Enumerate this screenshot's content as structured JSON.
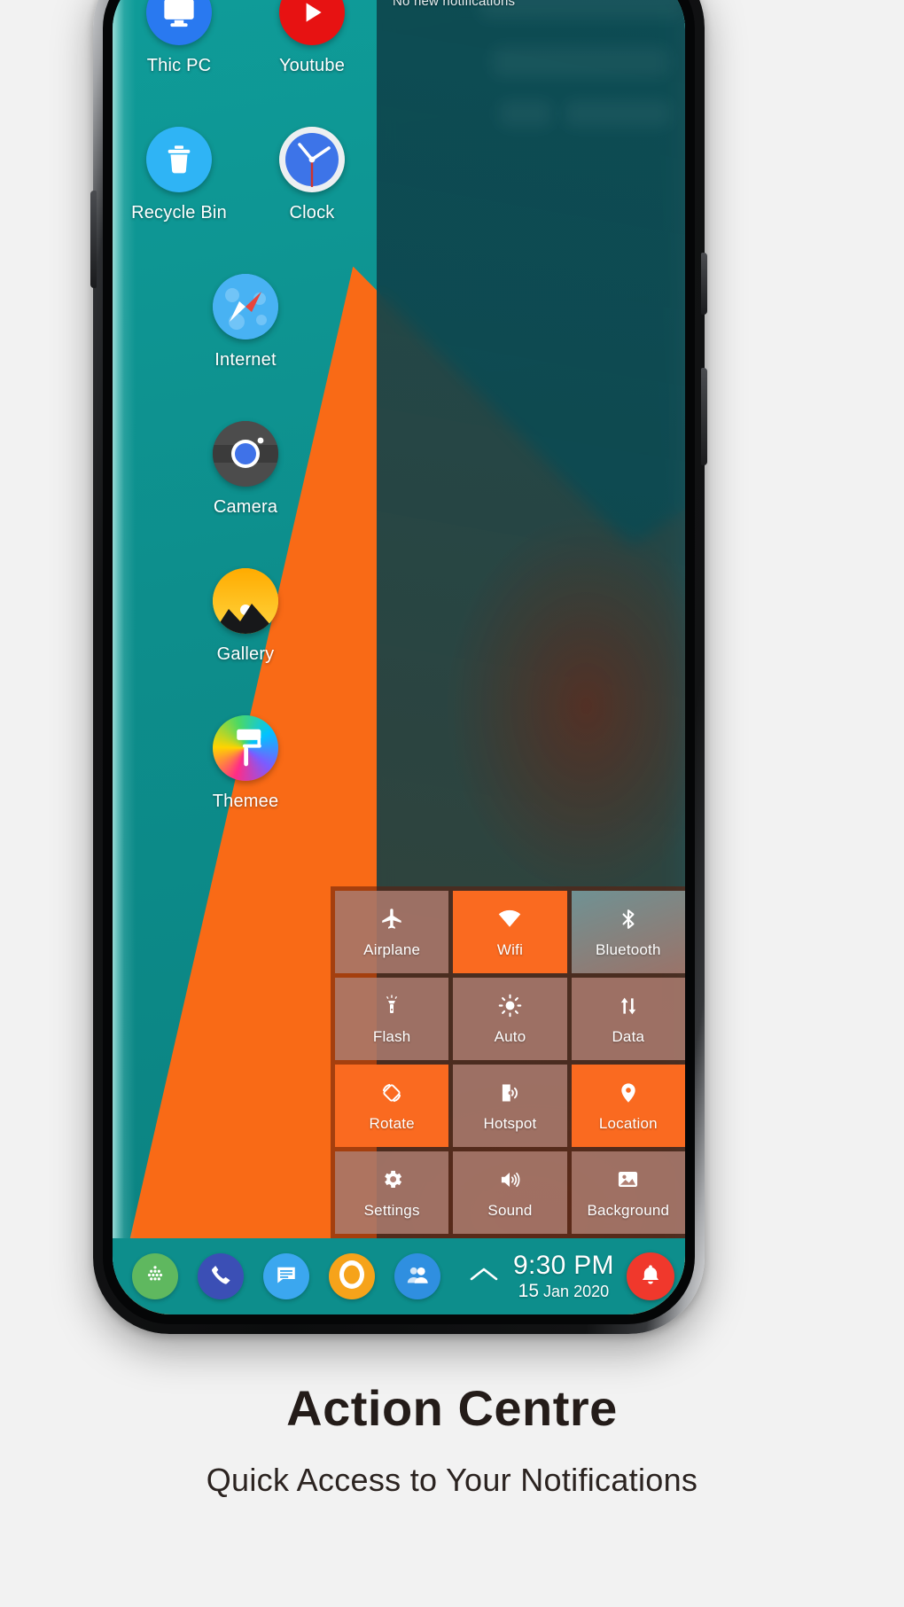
{
  "caption": {
    "title": "Action Centre",
    "subtitle": "Quick Access to Your Notifications"
  },
  "colors": {
    "background": "#f2f2f2",
    "taskbar_teal": "#0d8e8c",
    "wallpaper_teal": "#0b8f8f",
    "wallpaper_orange": "#f96a16",
    "tile_active": "#fa6a20",
    "tile_inactive": "#b08074",
    "bell_red": "#f0382c"
  },
  "notification_shade": {
    "empty_text": "No new notifications"
  },
  "desktop": {
    "icons": [
      {
        "label": "Thic PC",
        "icon": "monitor-icon"
      },
      {
        "label": "Youtube",
        "icon": "play-icon"
      },
      {
        "label": "Recycle Bin",
        "icon": "trash-icon"
      },
      {
        "label": "Clock",
        "icon": "clock-icon"
      },
      {
        "label": "Internet",
        "icon": "compass-icon"
      },
      {
        "label": "Camera",
        "icon": "camera-icon"
      },
      {
        "label": "Gallery",
        "icon": "landscape-icon"
      },
      {
        "label": "Themee",
        "icon": "paint-roller-icon"
      }
    ]
  },
  "quick_settings": {
    "tiles": [
      {
        "label": "Airplane",
        "icon": "airplane-icon",
        "state": "off",
        "style": "inactive"
      },
      {
        "label": "Wifi",
        "icon": "wifi-icon",
        "state": "on",
        "style": "active"
      },
      {
        "label": "Bluetooth",
        "icon": "bluetooth-icon",
        "state": "off",
        "style": "glass"
      },
      {
        "label": "Flash",
        "icon": "flashlight-icon",
        "state": "off",
        "style": "inactive"
      },
      {
        "label": "Auto",
        "icon": "brightness-icon",
        "state": "off",
        "style": "inactive"
      },
      {
        "label": "Data",
        "icon": "data-arrows-icon",
        "state": "off",
        "style": "inactive"
      },
      {
        "label": "Rotate",
        "icon": "rotate-icon",
        "state": "on",
        "style": "active"
      },
      {
        "label": "Hotspot",
        "icon": "hotspot-icon",
        "state": "off",
        "style": "inactive"
      },
      {
        "label": "Location",
        "icon": "location-pin-icon",
        "state": "on",
        "style": "active"
      },
      {
        "label": "Settings",
        "icon": "gear-icon",
        "state": "off",
        "style": "inactive"
      },
      {
        "label": "Sound",
        "icon": "speaker-icon",
        "state": "off",
        "style": "inactive"
      },
      {
        "label": "Background",
        "icon": "image-icon",
        "state": "off",
        "style": "inactive"
      }
    ]
  },
  "taskbar": {
    "apps": [
      {
        "name": "app-drawer",
        "icon": "grid-dots-icon"
      },
      {
        "name": "phone",
        "icon": "phone-icon"
      },
      {
        "name": "messages",
        "icon": "message-icon"
      },
      {
        "name": "ring",
        "icon": "circle-icon"
      },
      {
        "name": "contacts",
        "icon": "people-icon"
      }
    ],
    "expand_icon": "chevron-up-icon",
    "time": "9:30 PM",
    "date_day": "15",
    "date_month": "Jan",
    "date_year": "2020",
    "bell_icon": "bell-icon"
  }
}
